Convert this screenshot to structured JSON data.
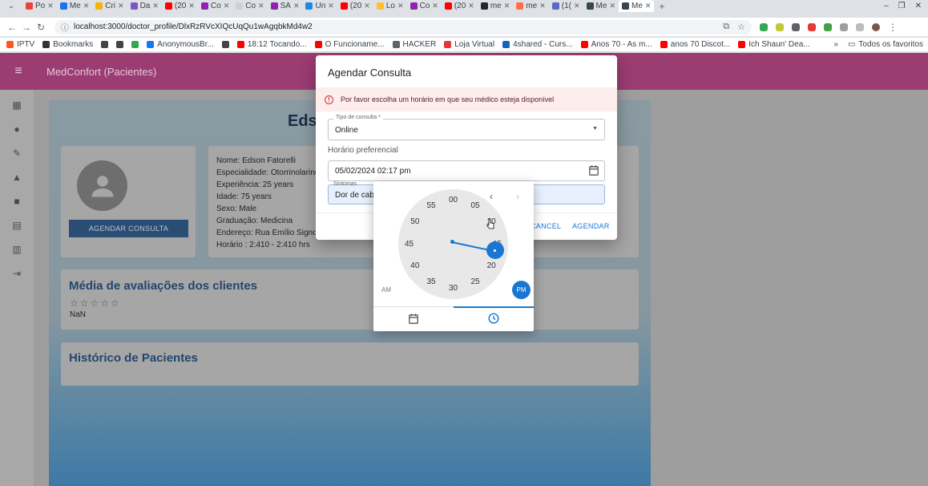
{
  "browser": {
    "tabs": [
      {
        "label": "Po",
        "color": "#ea4335",
        "icon": "gmail-icon"
      },
      {
        "label": "Me",
        "color": "#1a73e8",
        "icon": "meet-icon"
      },
      {
        "label": "Cri",
        "color": "#f4b400",
        "icon": "chrome-icon"
      },
      {
        "label": "Da",
        "color": "#7e57c2",
        "icon": "gemini-icon"
      },
      {
        "label": "(20",
        "color": "#ff0000",
        "icon": "youtube-icon"
      },
      {
        "label": "Co",
        "color": "#8e24aa",
        "icon": "openai-icon"
      },
      {
        "label": "Co",
        "color": "#d0d0d0",
        "icon": "blank-icon"
      },
      {
        "label": "SA",
        "color": "#8e24aa",
        "icon": "openai-icon"
      },
      {
        "label": "Un",
        "color": "#1e88e5",
        "icon": "udemy-icon"
      },
      {
        "label": "(20",
        "color": "#ff0000",
        "icon": "youtube-icon"
      },
      {
        "label": "Lo",
        "color": "#fbc02d",
        "icon": "bookmark-icon"
      },
      {
        "label": "Co",
        "color": "#8e24aa",
        "icon": "openai-icon"
      },
      {
        "label": "(20",
        "color": "#ff0000",
        "icon": "youtube-icon"
      },
      {
        "label": "me",
        "color": "#24292e",
        "icon": "github-icon"
      },
      {
        "label": "me",
        "color": "#ff7043",
        "icon": "gitlab-icon"
      },
      {
        "label": "(1(",
        "color": "#5c6bc0",
        "icon": "teams-icon"
      },
      {
        "label": "Me",
        "color": "#37474f",
        "icon": "app-icon"
      },
      {
        "label": "Me",
        "color": "#37474f",
        "icon": "app-icon"
      }
    ],
    "url": "localhost:3000/doctor_profile/DlxRzRVcXIQcUqQu1wAgqbkMd4w2",
    "bookmarks": [
      {
        "label": "IPTV",
        "color": "#ff5722"
      },
      {
        "label": "Bookmarks",
        "color": "#333333"
      },
      {
        "label": "",
        "color": "#444444"
      },
      {
        "label": "",
        "color": "#444444"
      },
      {
        "label": "",
        "color": "#34a853"
      },
      {
        "label": "AnonymousBr...",
        "color": "#1877f2"
      },
      {
        "label": "",
        "color": "#444444"
      },
      {
        "label": "18:12 Tocando...",
        "color": "#ff0000"
      },
      {
        "label": "O Funcioname...",
        "color": "#ff0000"
      },
      {
        "label": "HACKER",
        "color": "#5f6368"
      },
      {
        "label": "Loja Virtual",
        "color": "#e53935"
      },
      {
        "label": "4shared - Curs...",
        "color": "#1565c0"
      },
      {
        "label": "Anos 70 - As m...",
        "color": "#ff0000"
      },
      {
        "label": "anos 70 Discot...",
        "color": "#ff0000"
      },
      {
        "label": "Ich Shaun' Dea...",
        "color": "#ff0000"
      }
    ],
    "bookmarks_more": "»",
    "all_bookmarks": "Todos os favoritos"
  },
  "app": {
    "title": "MedConfort (Pacientes)",
    "header_partial": "Eds",
    "agendar_button": "AGENDAR CONSULTA",
    "doctor_info": [
      "Nome: Edson Fatorelli",
      "Especialidade: Otorrinolaringologia",
      "Experiência: 25 years",
      "Idade: 75 years",
      "Sexo: Male",
      "Graduação: Medicina",
      "Endereço: Rua Emílio Signori",
      "Horário : 2:410 - 2:410 hrs"
    ],
    "ratings_title": "Média de avaliações dos clientes",
    "stars": "☆☆☆☆☆",
    "rating_value": "NaN",
    "history_title": "Histórico de Pacientes"
  },
  "dialog": {
    "title": "Agendar Consulta",
    "alert": "Por favor escolha um horário em que seu médico esteja disponível",
    "tipo_label": "Tipo de consulta *",
    "tipo_value": "Online",
    "horario_label": "Horário preferencial",
    "horario_value": "05/02/2024 02:17 pm",
    "sintomas_label": "Sintomas",
    "sintomas_value": "Dor de cabeça",
    "cancel": "CANCEL",
    "agendar": "AGENDAR"
  },
  "clock": {
    "minute_labels": [
      "00",
      "05",
      "10",
      "15",
      "20",
      "25",
      "30",
      "35",
      "40",
      "45",
      "50",
      "55"
    ],
    "selected_minute": 17,
    "am": "AM",
    "pm": "PM",
    "meridiem_selected": "PM",
    "active_tab": "clock"
  },
  "colors": {
    "appbar": "#9b3c72",
    "accent": "#1976d2",
    "error": "#d32f2f"
  }
}
